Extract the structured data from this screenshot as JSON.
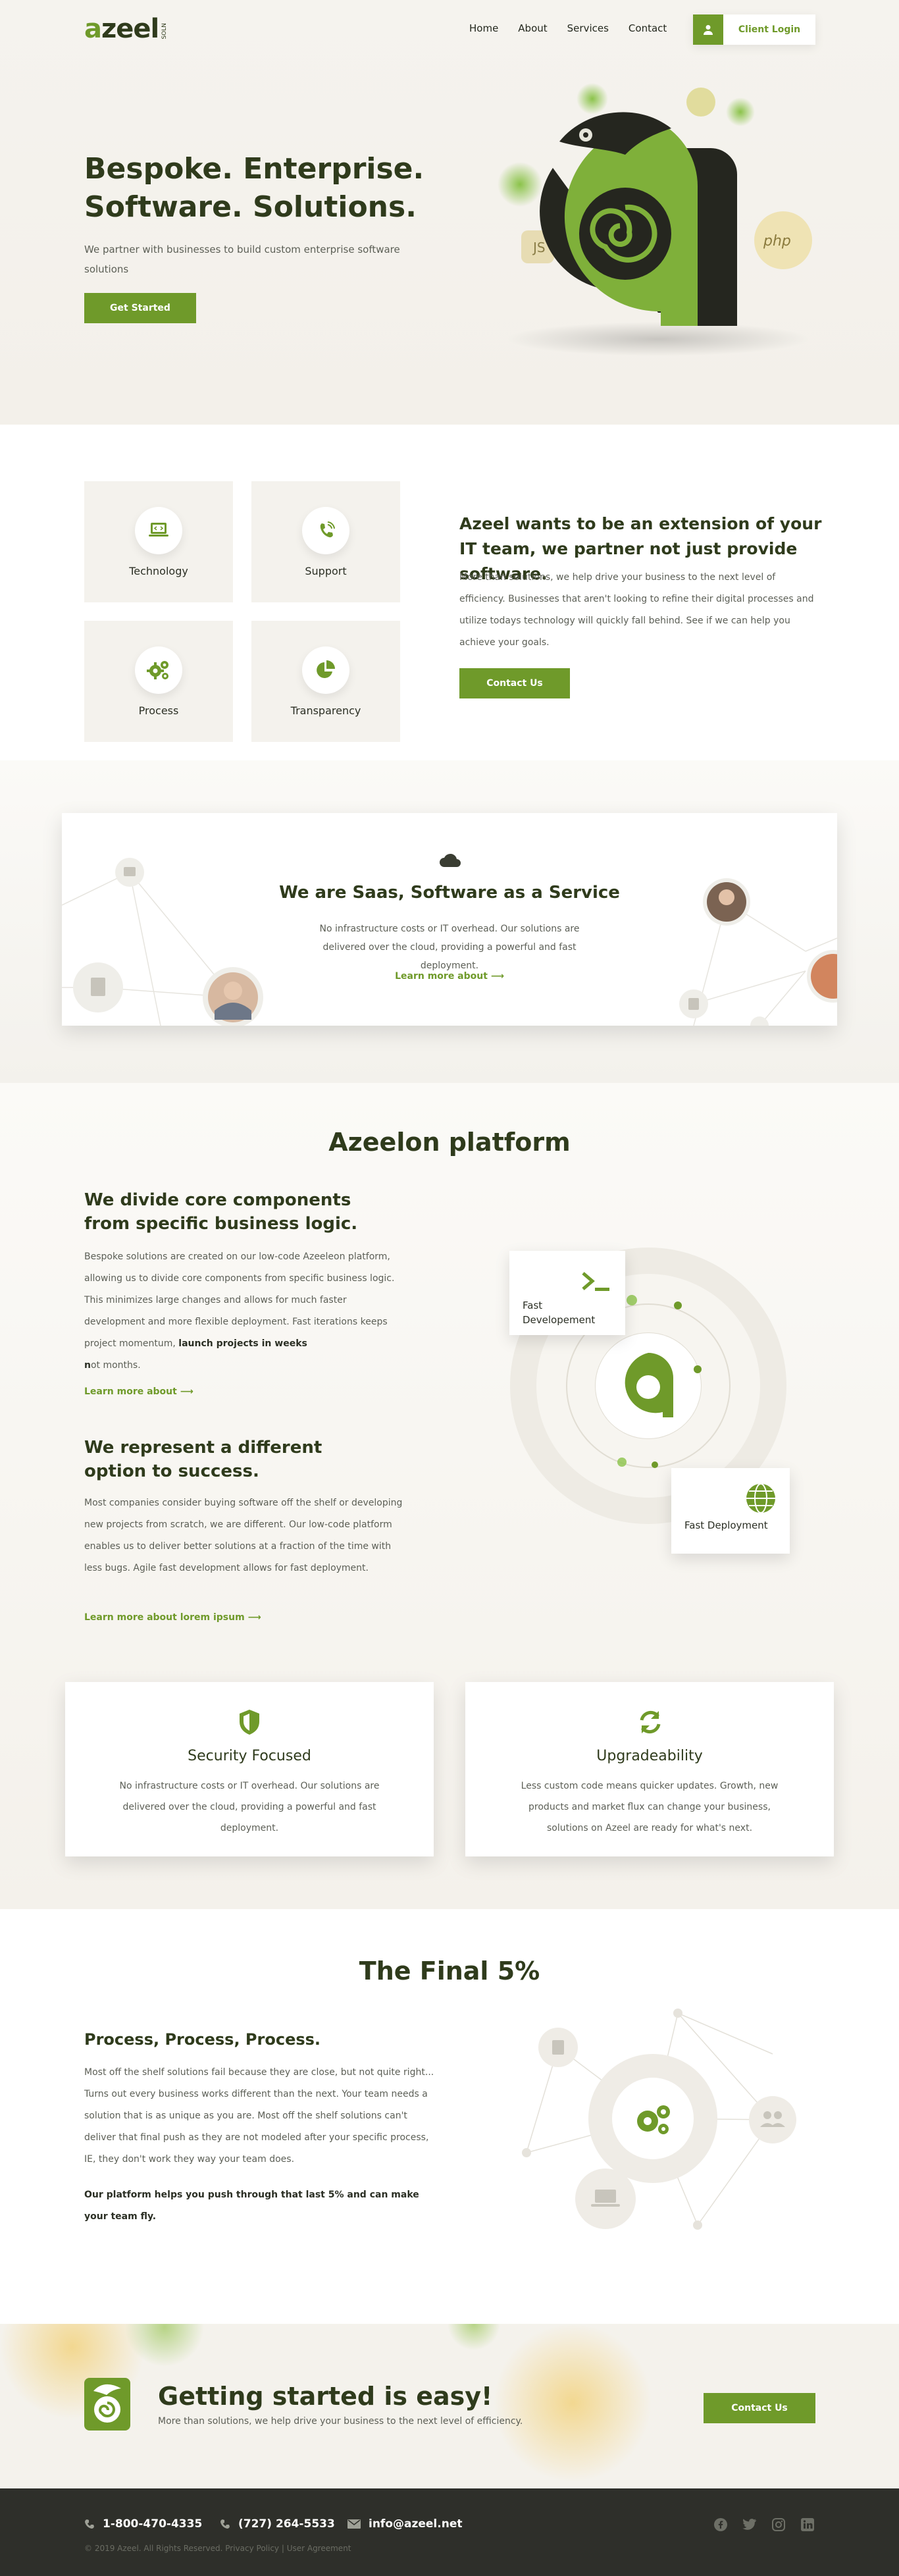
{
  "header": {
    "logo_text": "azeel",
    "logo_sub": "SOLN",
    "nav": [
      "Home",
      "About",
      "Services",
      "Contact"
    ],
    "login_label": "Client Login"
  },
  "hero": {
    "title_line1": "Bespoke. Enterprise.",
    "title_line2": "Software. Solutions.",
    "description": "We partner with businesses to build custom enterprise software solutions",
    "button": "Get Started",
    "badge_js": "JS",
    "badge_php": "php"
  },
  "features": {
    "tiles": [
      "Technology",
      "Support",
      "Process",
      "Transparency"
    ],
    "title": "Azeel wants to be an extension of your IT team, we partner not just provide software.",
    "body": "More than solutions, we help drive your business to the next level of efficiency.  Businesses that aren't looking to refine their digital processes and utilize todays technology will quickly fall behind.  See if we can help you achieve your goals.",
    "button": "Contact Us"
  },
  "saas": {
    "title": "We are Saas, Software as a Service",
    "body": "No infrastructure costs or IT overhead.  Our solutions are delivered over the cloud, providing a powerful and fast deployment.",
    "link": "Learn more about"
  },
  "platform": {
    "title": "Azeelon platform",
    "block1_title": "We divide core components from specific business logic.",
    "block1_body": "Bespoke solutions are created on our low-code Azeeleon platform, allowing us to divide core components from specific business logic.  This minimizes large changes and allows for much faster development and more flexible deployment.  Fast iterations keeps project momentum, ",
    "block1_bold": "launch projects in weeks",
    "block1_tail_n": "n",
    "block1_tail": "ot months.",
    "block1_link": "Learn more about",
    "block2_title": "We represent a different option to success.",
    "block2_body": "Most companies consider buying software off the shelf or developing new projects from scratch, we are different.  Our low-code platform enables us to deliver better solutions at a fraction of the time with less bugs.  Agile fast development allows for fast deployment.",
    "block2_link": "Learn more about lorem ipsum",
    "card1_label": "Fast Developement",
    "card2_label": "Fast Deployment",
    "security_title": "Security Focused",
    "security_body": "No infrastructure costs or IT overhead.  Our solutions are delivered over the cloud, providing a powerful and fast deployment.",
    "upgrade_title": "Upgradeability",
    "upgrade_body": "Less custom code means quicker updates. Growth, new products and market flux can change your business, solutions on Azeel are ready for what's next."
  },
  "final": {
    "title": "The Final 5%",
    "subtitle": "Process, Process, Process.",
    "body": "Most off the shelf solutions fail because they are close, but not quite right...  Turns out every business works different than the next. Your team needs a solution that is as unique as you are. Most off the shelf solutions can't deliver that final push as they are not modeled after your specific process, IE, they don't work they way your team does.",
    "bold": "Our platform helps you push through that last 5% and can make your team fly."
  },
  "cta": {
    "title": "Getting started is easy!",
    "subtitle": "More than solutions, we help drive your business to the next level of efficiency.",
    "button": "Contact Us"
  },
  "footer": {
    "phone1": "1-800-470-4335",
    "phone2": "(727) 264-5533",
    "email": "info@azeel.net",
    "copyright": "© 2019 Azeel. All Rights Reserved. Privacy Policy | User Agreement",
    "socials": [
      "facebook-icon",
      "twitter-icon",
      "instagram-icon",
      "linkedin-icon"
    ]
  },
  "colors": {
    "brand_green": "#6f9a2a",
    "dark_green": "#2f3b1c",
    "footer_bg": "#2e2f2a"
  }
}
